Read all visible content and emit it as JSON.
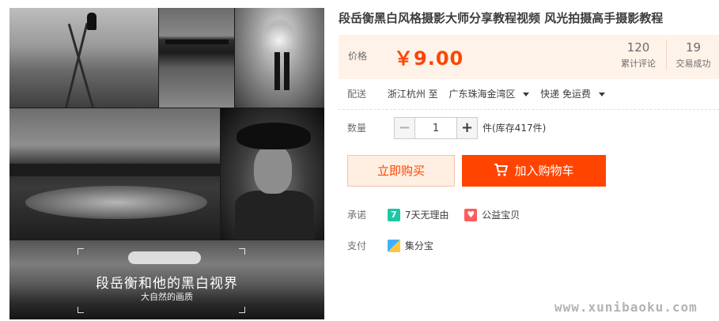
{
  "product": {
    "title": "段岳衡黑白风格摄影大师分享教程视频 风光拍摄高手摄影教程",
    "image": {
      "overlay_title": "段岳衡和他的黑白视界",
      "overlay_subtitle": "大自然的画质"
    }
  },
  "price": {
    "label": "价格",
    "value": "￥9.00",
    "reviews_count": "120",
    "reviews_label": "累计评论",
    "deals_count": "19",
    "deals_label": "交易成功"
  },
  "shipping": {
    "label": "配送",
    "from": "浙江杭州 至",
    "to": "广东珠海金湾区",
    "method": "快递 免运费"
  },
  "quantity": {
    "label": "数量",
    "minus": "−",
    "value": "1",
    "plus": "+",
    "stock": "件(库存417件)"
  },
  "actions": {
    "buy_now": "立即购买",
    "add_to_cart": "加入购物车"
  },
  "promise": {
    "label": "承诺",
    "items": [
      {
        "badge": "7",
        "text": "7天无理由",
        "icon": "seven-day-return-icon"
      },
      {
        "badge": "♥",
        "text": "公益宝贝",
        "icon": "charity-heart-icon"
      }
    ]
  },
  "payment": {
    "label": "支付",
    "method": "集分宝",
    "icon": "jifenbao-icon"
  },
  "watermark": "www.xunibaoku.com",
  "colors": {
    "accent": "#ff4400",
    "price_panel_bg": "#fff2e8",
    "buy_now_bg": "#ffeee2"
  }
}
